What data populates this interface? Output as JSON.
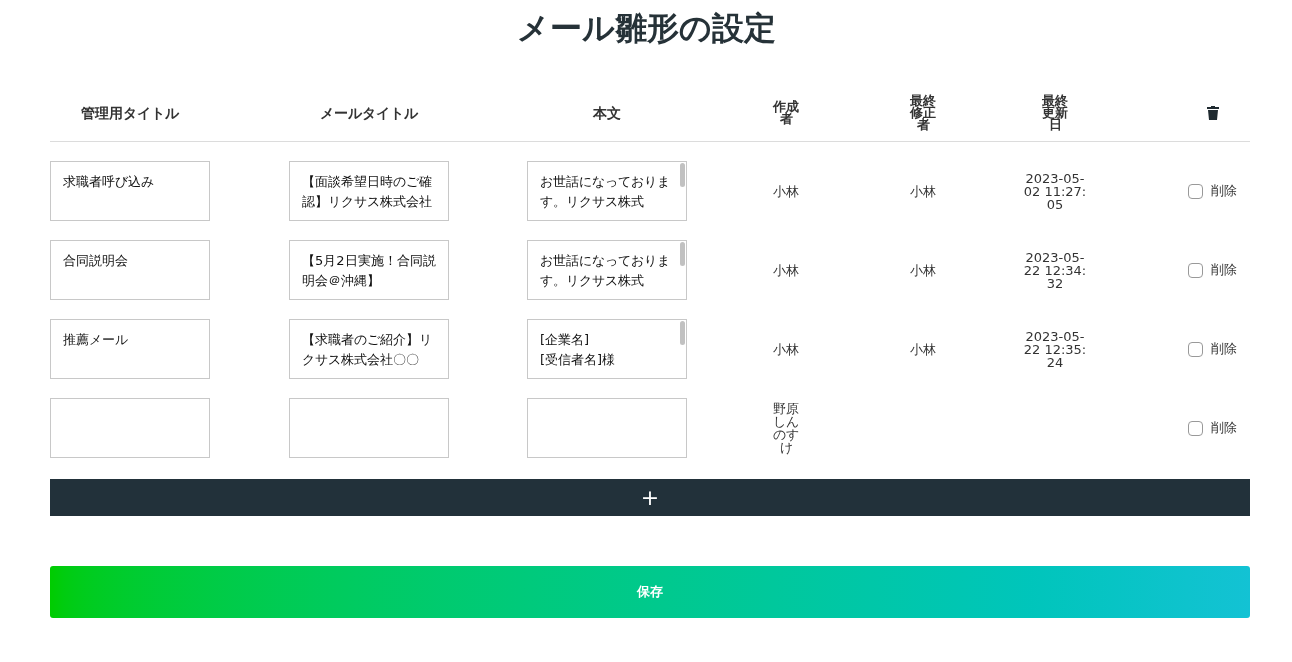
{
  "title": "メール雛形の設定",
  "columns": [
    "管理用タイトル",
    "メールタイトル",
    "本文",
    "作成者",
    "最終修正者",
    "最終更新日"
  ],
  "rows": [
    {
      "admin_title": "求職者呼び込み",
      "mail_title": "【面談希望日時のご確認】リクサス株式会社",
      "body": "お世話になっております。リクサス株式",
      "creator": "小林",
      "modifier": "小林",
      "updated": "2023-05-02 11:27:05",
      "delete": {
        "label": "削除",
        "checked": false
      }
    },
    {
      "admin_title": "合同説明会",
      "mail_title": "【5月2日実施！合同説明会＠沖縄】",
      "body": "お世話になっております。リクサス株式",
      "creator": "小林",
      "modifier": "小林",
      "updated": "2023-05-22 12:34:32",
      "delete": {
        "label": "削除",
        "checked": false
      }
    },
    {
      "admin_title": "推薦メール",
      "mail_title": "【求職者のご紹介】リクサス株式会社〇〇",
      "body": "[企業名]\n[受信者名]様",
      "creator": "小林",
      "modifier": "小林",
      "updated": "2023-05-22 12:35:24",
      "delete": {
        "label": "削除",
        "checked": false
      }
    },
    {
      "creator": "野原しんのすけ",
      "delete": {
        "label": "削除",
        "checked": false
      }
    }
  ],
  "add_button": "+",
  "save_button": "保存"
}
